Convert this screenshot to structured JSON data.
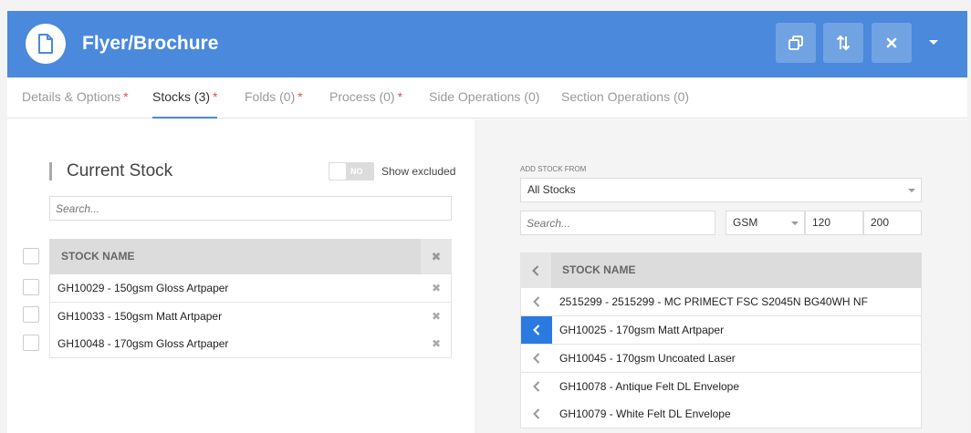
{
  "header": {
    "title": "Flyer/Brochure",
    "icons": [
      "document-icon",
      "copy-icon",
      "sort-icon",
      "close-icon",
      "chevron-down-icon"
    ]
  },
  "tabs": [
    {
      "label": "Details & Options",
      "required": "*"
    },
    {
      "label": "Stocks (3)",
      "required": "*"
    },
    {
      "label": "Folds (0)",
      "required": "*"
    },
    {
      "label": "Process (0)",
      "required": "*"
    },
    {
      "label": "Side Operations (0)",
      "required": ""
    },
    {
      "label": "Section Operations (0)",
      "required": ""
    }
  ],
  "current_stock": {
    "title": "Current Stock",
    "toggle_label": "NO",
    "show_excluded_label": "Show excluded",
    "search_placeholder": "Search...",
    "column_header": "STOCK NAME",
    "rows": [
      "GH10029 - 150gsm Gloss Artpaper",
      "GH10033 - 150gsm Matt Artpaper",
      "GH10048 - 170gsm Gloss Artpaper"
    ]
  },
  "add_stock": {
    "label": "ADD STOCK FROM",
    "source_value": "All Stocks",
    "search_placeholder": "Search...",
    "unit_value": "GSM",
    "min_value": "120",
    "max_value": "200",
    "column_header": "STOCK NAME",
    "rows": [
      "2515299 - 2515299 - MC PRIMECT FSC S2045N BG40WH NF",
      "GH10025 - 170gsm Matt Artpaper",
      "GH10045 - 170gsm Uncoated Laser",
      "GH10078 - Antique Felt DL Envelope",
      "GH10079 - White Felt DL Envelope"
    ]
  },
  "colors": {
    "header": "#4a89dc",
    "required": "#d9534f",
    "active_row": "#2a7ae2"
  }
}
